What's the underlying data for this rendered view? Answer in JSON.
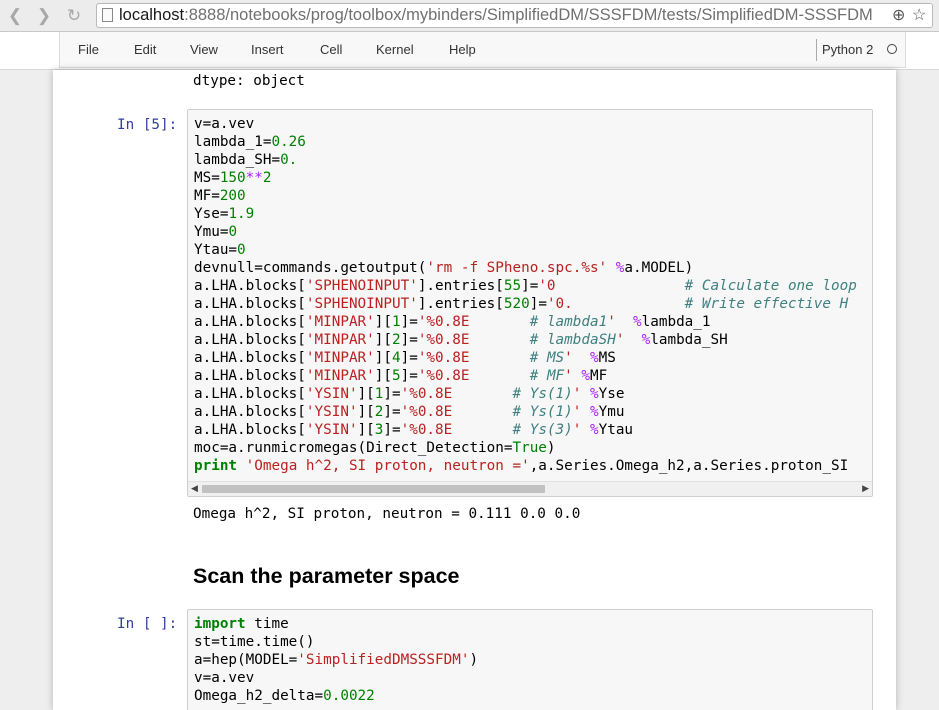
{
  "browser": {
    "url_host": "localhost",
    "url_rest": ":8888/notebooks/prog/toolbox/mybinders/SimplifiedDM/SSSFDM/tests/SimplifiedDM-SSSFDM"
  },
  "menu": {
    "items": [
      "File",
      "Edit",
      "View",
      "Insert",
      "Cell",
      "Kernel",
      "Help"
    ],
    "kernel": "Python 2"
  },
  "cells": {
    "dtype_output": "dtype: object",
    "cell5_prompt": "In [5]:",
    "cell5_output": "Omega h^2, SI proton, neutron = 0.111 0.0 0.0",
    "heading": "Scan the parameter space",
    "cell_next_prompt": "In [ ]:",
    "cell5_lines": [
      "v=a.vev",
      "lambda_1=0.26",
      "lambda_SH=0.",
      "MS=150**2",
      "MF=200",
      "Yse=1.9",
      "Ymu=0",
      "Ytau=0",
      "devnull=commands.getoutput('rm -f SPheno.spc.%s' %a.MODEL)",
      "a.LHA.blocks['SPHENOINPUT'].entries[55]='0               # Calculate one loop",
      "a.LHA.blocks['SPHENOINPUT'].entries[520]='0.             # Write effective H",
      "a.LHA.blocks['MINPAR'][1]='%0.8E       # lambda1'  %lambda_1",
      "a.LHA.blocks['MINPAR'][2]='%0.8E       # lambdaSH'  %lambda_SH",
      "a.LHA.blocks['MINPAR'][4]='%0.8E       # MS'  %MS",
      "a.LHA.blocks['MINPAR'][5]='%0.8E       # MF' %MF",
      "a.LHA.blocks['YSIN'][1]='%0.8E       # Ys(1)' %Yse",
      "a.LHA.blocks['YSIN'][2]='%0.8E       # Ys(1)' %Ymu",
      "a.LHA.blocks['YSIN'][3]='%0.8E       # Ys(3)' %Ytau",
      "moc=a.runmicromegas(Direct_Detection=True)",
      "print 'Omega h^2, SI proton, neutron =',a.Series.Omega_h2,a.Series.proton_SI"
    ],
    "cell_next_lines": [
      "import time",
      "st=time.time()",
      "a=hep(MODEL='SimplifiedDMSSSFDM')",
      "v=a.vev",
      "Omega_h2_delta=0.0022"
    ]
  }
}
